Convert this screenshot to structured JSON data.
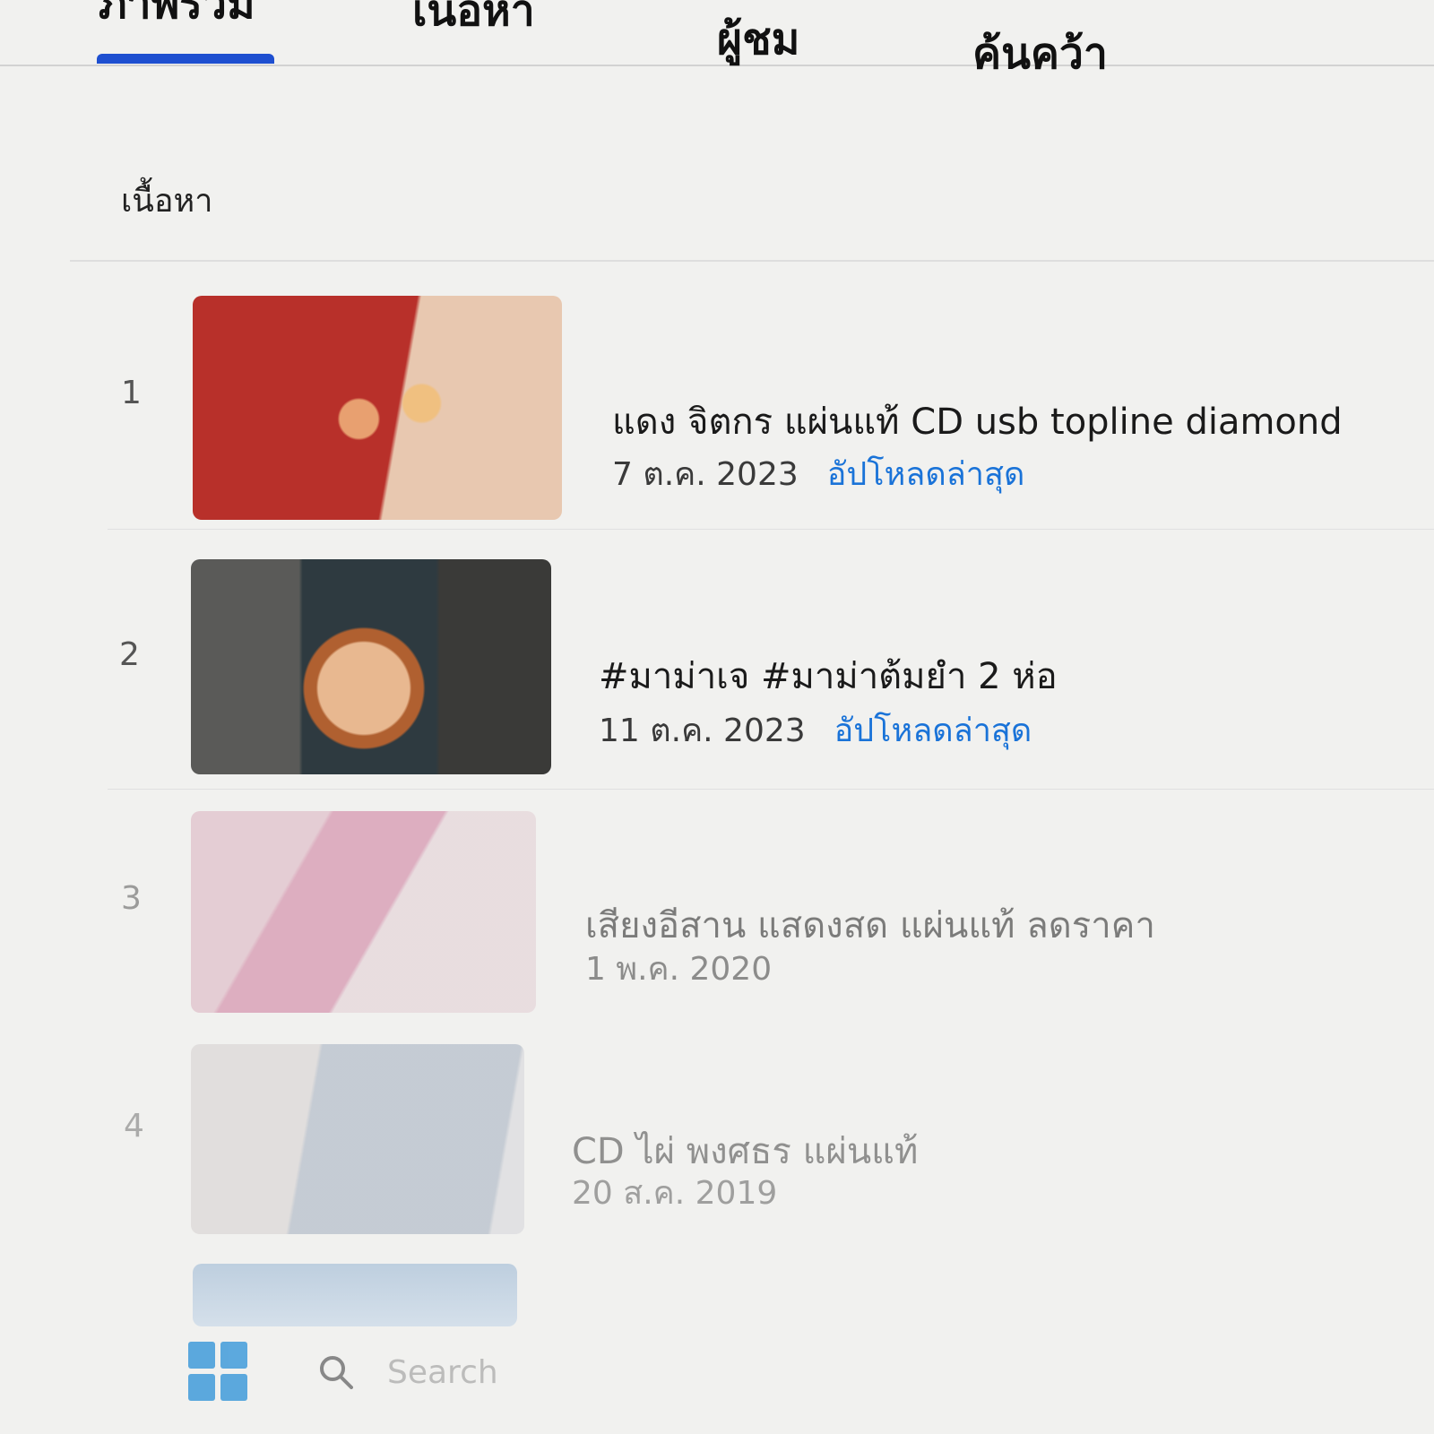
{
  "tabs": [
    {
      "label": "ภาพรวม"
    },
    {
      "label": "เนื้อหา"
    },
    {
      "label": "ผู้ชม"
    },
    {
      "label": "ค้นคว้า"
    }
  ],
  "section": {
    "title": "เนื้อหา"
  },
  "items": [
    {
      "rank": "1",
      "title": "แดง จิตกร แผ่นแท้ CD usb topline diamond",
      "date": "7 ต.ค. 2023",
      "badge": "อัปโหลดล่าสุด"
    },
    {
      "rank": "2",
      "title": "#มาม่าเจ #มาม่าต้มยำ 2 ห่อ",
      "date": "11 ต.ค. 2023",
      "badge": "อัปโหลดล่าสุด"
    },
    {
      "rank": "3",
      "title": "เสียงอีสาน แสดงสด แผ่นแท้ ลดราคา",
      "date": "1 พ.ค. 2020",
      "badge": ""
    },
    {
      "rank": "4",
      "title": "CD ไผ่ พงศธร แผ่นแท้",
      "date": "20 ส.ค. 2019",
      "badge": ""
    }
  ],
  "taskbar": {
    "search_placeholder": "Search",
    "start_icon": "windows-start-icon",
    "search_icon": "search-icon"
  },
  "colors": {
    "accent": "#1e4fd0",
    "link": "#1a73d8"
  }
}
